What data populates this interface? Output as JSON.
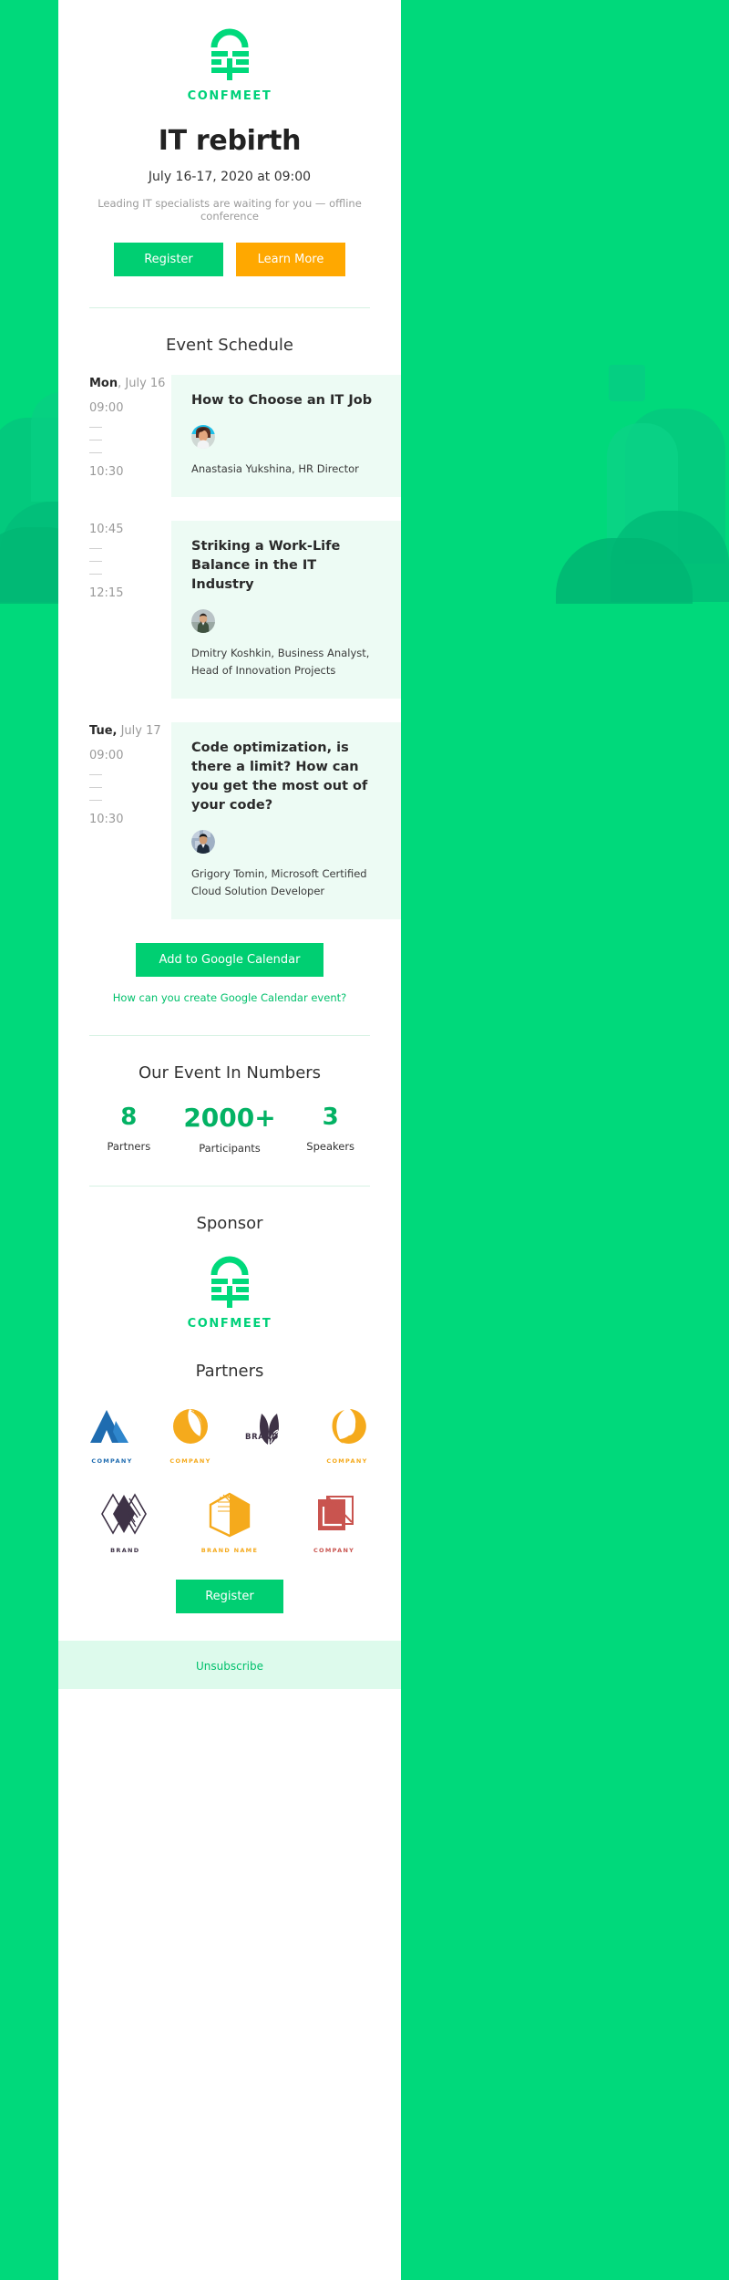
{
  "brand": {
    "name": "CONFMEET",
    "logo_icon": "confmeet-lock-logo-icon",
    "accent_green": "#00d97b",
    "button_green": "#00cf72",
    "button_orange": "#ffa800",
    "panel_mint": "#edfbf4"
  },
  "hero": {
    "title": "IT rebirth",
    "date": "July 16-17, 2020 at 09:00",
    "tagline": "Leading IT specialists are waiting for you — offline conference",
    "primary_cta": "Register",
    "secondary_cta": "Learn More"
  },
  "schedule": {
    "heading": "Event Schedule",
    "sessions": [
      {
        "day_abbr": "Mon",
        "day_date": ", July 16",
        "start": "09:00",
        "end": "10:30",
        "title": "How to Choose an IT Job",
        "speaker": "Anastasia Yukshina, HR Director",
        "avatar_icon": "speaker-avatar-anastasia-icon"
      },
      {
        "day_abbr": "",
        "day_date": "",
        "start": "10:45",
        "end": "12:15",
        "title": "Striking a Work-Life Balance in the IT Industry",
        "speaker": "Dmitry Koshkin, Business Analyst, Head of Innovation Projects",
        "avatar_icon": "speaker-avatar-dmitry-icon"
      },
      {
        "day_abbr": "Tue,",
        "day_date": " July 17",
        "start": "09:00",
        "end": "10:30",
        "title": "Code optimization, is there a limit? How can you get the most out of your code?",
        "speaker": "Grigory Tomin, Microsoft Certified Cloud Solution Developer",
        "avatar_icon": "speaker-avatar-grigory-icon"
      }
    ],
    "calendar_button": "Add to Google Calendar",
    "calendar_help_link": "How can you create Google Calendar event?"
  },
  "numbers": {
    "heading": "Our Event In Numbers",
    "items": [
      {
        "value": "8",
        "label": "Partners"
      },
      {
        "value": "2000+",
        "label": "Participants"
      },
      {
        "value": "3",
        "label": "Speakers"
      }
    ]
  },
  "sponsor": {
    "heading": "Sponsor",
    "name": "CONFMEET",
    "logo_icon": "confmeet-lock-logo-icon"
  },
  "partners": {
    "heading": "Partners",
    "row1": [
      {
        "name": "COMPANY",
        "color": "#1f6cb0",
        "icon": "partner-triangle-mountain-icon"
      },
      {
        "name": "COMPANY",
        "color": "#f5aa1c",
        "icon": "partner-circle-leaf-icon"
      },
      {
        "name": "BRAND",
        "color": "#3e3246",
        "icon": "partner-leaves-icon"
      },
      {
        "name": "COMPANY",
        "color": "#f5aa1c",
        "icon": "partner-crescent-o-icon"
      }
    ],
    "row2": [
      {
        "name": "BRAND",
        "color": "#3e3246",
        "icon": "partner-diamonds-icon"
      },
      {
        "name": "BRAND NAME",
        "color": "#f5aa1c",
        "icon": "partner-hexagon-icon"
      },
      {
        "name": "COMPANY",
        "color": "#c9544f",
        "icon": "partner-square-corner-icon"
      }
    ]
  },
  "footer": {
    "register_label": "Register",
    "unsubscribe_label": "Unsubscribe"
  }
}
